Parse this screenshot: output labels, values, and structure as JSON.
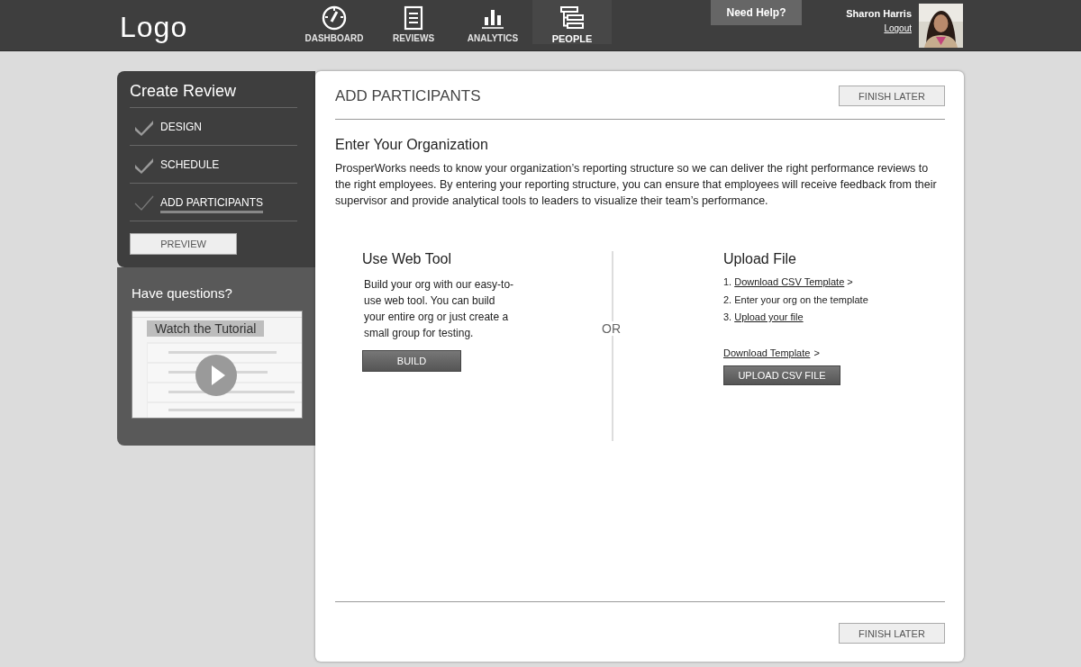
{
  "header": {
    "logo": "Logo",
    "nav": [
      {
        "label": "DASHBOARD",
        "selected": false
      },
      {
        "label": "REVIEWS",
        "selected": false
      },
      {
        "label": "ANALYTICS",
        "selected": false
      },
      {
        "label": "PEOPLE",
        "selected": true
      }
    ],
    "help": "Need Help?",
    "user": {
      "name": "Sharon Harris",
      "logout": "Logout"
    }
  },
  "sidebar": {
    "title": "Create Review",
    "steps": [
      {
        "label": "DESIGN",
        "done": true,
        "selected": false
      },
      {
        "label": "SCHEDULE",
        "done": true,
        "selected": false
      },
      {
        "label": "ADD PARTICIPANTS",
        "done": false,
        "selected": true
      }
    ],
    "preview": "PREVIEW",
    "questions": "Have questions?",
    "tutorial": {
      "label": "Watch the Tutorial"
    }
  },
  "main": {
    "title": "ADD PARTICIPANTS",
    "finish_top": "FINISH LATER",
    "heading": "Enter Your Organization",
    "intro": "ProsperWorks needs to know your organization’s reporting structure so we can deliver the right performance reviews to the right employees.  By entering your reporting structure, you can ensure that employees will receive feedback from their supervisor and provide analytical tools to leaders to visualize their team’s performance.",
    "web_tool": {
      "title": "Use Web Tool",
      "text": "Build your org with our easy-to-use web tool.  You can build your entire org or just create a small group for testing.",
      "button": "BUILD"
    },
    "or": "OR",
    "upload": {
      "title": "Upload File",
      "steps": [
        {
          "num": "1.",
          "text": "Download CSV Template",
          "kind": "link",
          "suffix": ">"
        },
        {
          "num": "2.",
          "text": "Enter your org on the template",
          "kind": "text"
        },
        {
          "num": "3.",
          "text": "Upload your file",
          "kind": "link"
        }
      ],
      "download": "Download Template",
      "download_suffix": ">",
      "button": "UPLOAD CSV FILE"
    },
    "finish_bottom": "FINISH LATER"
  }
}
